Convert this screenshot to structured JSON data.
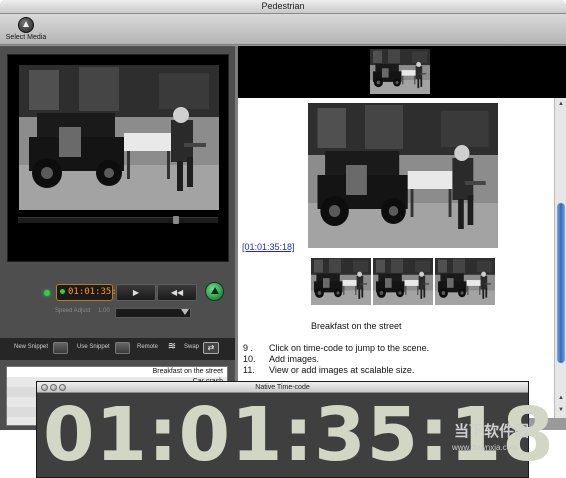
{
  "window": {
    "title": "Pedestrian"
  },
  "toolbar": {
    "select_media_label": "Select Media"
  },
  "player": {
    "timecode": "01:01:35:18",
    "speed_label": "Speed Adjust",
    "speed_value": "1.00",
    "speed_level": 0.95,
    "scrub_position": 0.8
  },
  "snippets": {
    "new_label": "New Snippet",
    "use_label": "Use Snippet",
    "remote_label": "Remote",
    "swap_label": "Swap",
    "items": [
      "Breakfast on the street",
      "Car crash"
    ]
  },
  "document": {
    "timecode_link": "[01:01:35:18]",
    "caption": "Breakfast on the street",
    "steps": [
      {
        "num": "9 .",
        "text": "Click on time-code to jump to the scene."
      },
      {
        "num": "10.",
        "text": "Add images."
      },
      {
        "num": "11.",
        "text": "View or add images at scalable size."
      }
    ]
  },
  "native_timecode": {
    "title": "Native Time-code",
    "display": "01:01:35:18"
  },
  "watermark": {
    "big": "当下软件园",
    "url": "www.downxia.com"
  },
  "colors": {
    "timecode_orange": "#ff9a1a",
    "link_blue": "#1a2bc8",
    "led_green": "#30d040",
    "scroll_blue": "#2f6bc2"
  }
}
